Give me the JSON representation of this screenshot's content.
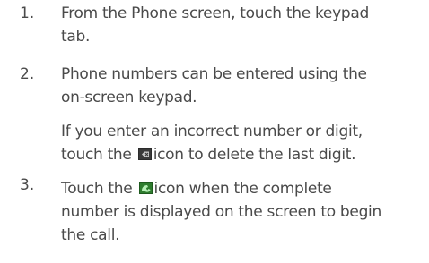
{
  "steps": [
    {
      "number": "1.",
      "lines": [
        "From the Phone screen, touch the keypad",
        "tab."
      ]
    },
    {
      "number": "2.",
      "lines": [
        "Phone numbers can be entered using the",
        "on-screen keypad."
      ]
    },
    {
      "note_line1": "If you enter an incorrect number or digit,",
      "note_line2_before": "touch the",
      "note_line2_after": "icon to delete the last digit.",
      "icon": "backspace-delete-icon"
    },
    {
      "number": "3.",
      "line1_before": "Touch the",
      "line1_after": "icon when the complete",
      "lines": [
        "number is displayed on the screen to begin",
        "the call."
      ],
      "icon": "call-dial-icon"
    }
  ],
  "colors": {
    "text": "#4a4a4a",
    "delete_icon_bg": "#2b2b2b",
    "call_icon_bg": "#1e5a1e"
  }
}
